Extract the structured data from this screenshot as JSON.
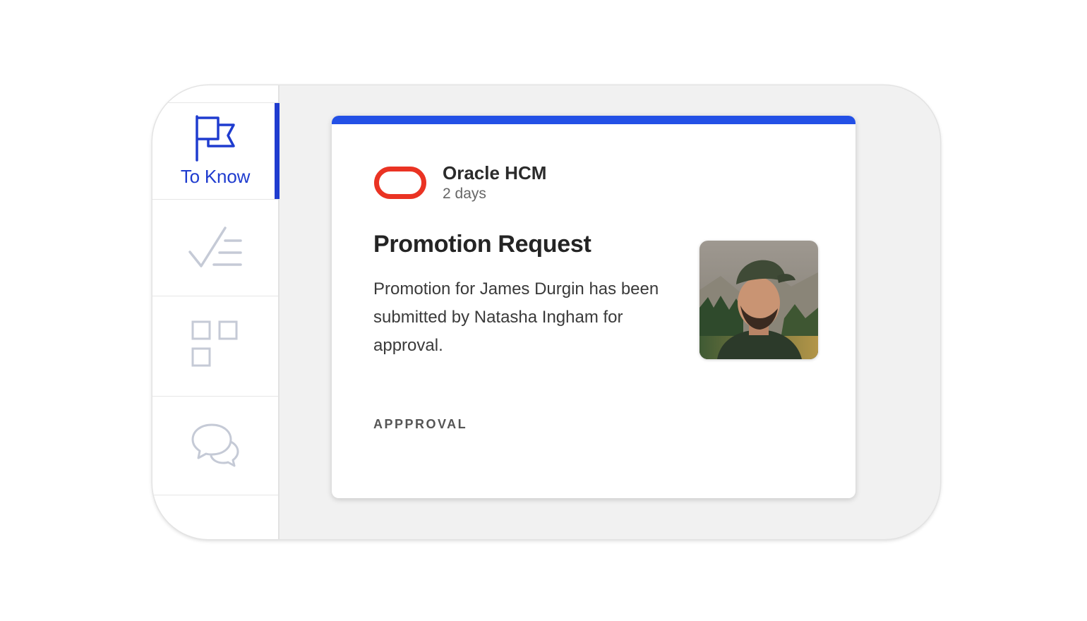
{
  "sidebar": {
    "items": [
      {
        "label": "To Know",
        "icon": "flag-icon",
        "active": true
      },
      {
        "label": "",
        "icon": "checklist-icon",
        "active": false
      },
      {
        "label": "",
        "icon": "apps-grid-icon",
        "active": false
      },
      {
        "label": "",
        "icon": "chat-bubbles-icon",
        "active": false
      }
    ]
  },
  "card": {
    "source": "Oracle HCM",
    "time": "2 days",
    "title": "Promotion Request",
    "body": "Promotion for James Durgin has been submitted by Natasha Ingham for approval.",
    "tag": "APPPROVAL",
    "logo_icon": "oracle-logo-icon",
    "avatar_icon": "person-avatar-photo"
  },
  "colors": {
    "accent": "#1f3ccf",
    "card_bar": "#2350e6",
    "logo": "#ea3323",
    "inactive_icon": "#c5cad6"
  }
}
